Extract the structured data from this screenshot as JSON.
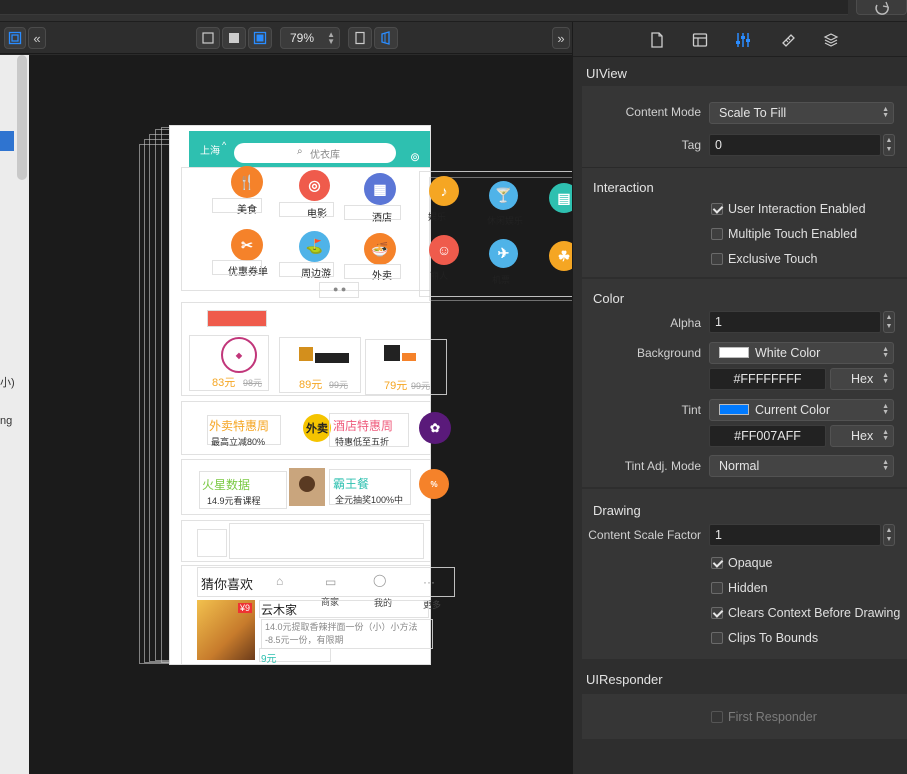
{
  "toolbar": {
    "zoom_value": "79%"
  },
  "left_panel": {
    "frag1": "小)",
    "frag2": "ng"
  },
  "phone": {
    "city": "上海",
    "search_placeholder": "优衣库",
    "categories": [
      "美食",
      "电影",
      "酒店",
      "优惠券单",
      "周边游",
      "外卖"
    ],
    "side_categories": [
      "娱乐",
      "休闲娱乐",
      "丽人",
      "机票"
    ],
    "deals": [
      {
        "price": "83元",
        "old": "98元"
      },
      {
        "price": "89元",
        "old": "99元"
      },
      {
        "price": "79元",
        "old": "99元"
      }
    ],
    "promo1_title": "外卖特惠周",
    "promo1_sub": "最高立减80%",
    "promo1_badge": "外卖",
    "promo2_title": "酒店特惠周",
    "promo2_sub": "特惠低至五折",
    "promo3_title": "火星数据",
    "promo3_sub": "14.9元看课程",
    "promo4_title": "霸王餐",
    "promo4_sub": "全元抽奖100%中",
    "guess_title": "猜你喜欢",
    "tabbar": [
      "商家",
      "我的",
      "更多"
    ],
    "item_shop": "云木家",
    "item_desc": "14.0元提取香辣拌面一份（小）小方法 -8.5元一份，有限期",
    "item_price": "9元",
    "item_img_tag": "¥9"
  },
  "inspector": {
    "uiview_title": "UIView",
    "content_mode_label": "Content Mode",
    "content_mode_value": "Scale To Fill",
    "tag_label": "Tag",
    "tag_value": "0",
    "interaction_title": "Interaction",
    "cb_user_interaction": "User Interaction Enabled",
    "cb_multiple_touch": "Multiple Touch Enabled",
    "cb_exclusive_touch": "Exclusive Touch",
    "color_title": "Color",
    "alpha_label": "Alpha",
    "alpha_value": "1",
    "background_label": "Background",
    "background_value": "White Color",
    "background_hex": "#FFFFFFFF",
    "hex_label": "Hex",
    "tint_label": "Tint",
    "tint_value": "Current Color",
    "tint_hex": "#FF007AFF",
    "tint_adj_label": "Tint Adj. Mode",
    "tint_adj_value": "Normal",
    "drawing_title": "Drawing",
    "content_scale_label": "Content Scale Factor",
    "content_scale_value": "1",
    "cb_opaque": "Opaque",
    "cb_hidden": "Hidden",
    "cb_clears_context": "Clears Context Before Drawing",
    "cb_clips_bounds": "Clips To Bounds",
    "uiresponder_title": "UIResponder",
    "cb_first_responder": "First Responder"
  },
  "colors": {
    "accent": "#2a8cff",
    "teal_header": "#2ec0b0",
    "background_swatch": "#FFFFFF",
    "tint_swatch": "#007AFF"
  },
  "icons": [
    "zoom-to-fit-icon",
    "collapse-left-icon",
    "collapse-right-icon",
    "file-inspector-icon",
    "quick-help-icon",
    "attributes-inspector-icon",
    "size-inspector-icon",
    "connections-inspector-icon"
  ]
}
